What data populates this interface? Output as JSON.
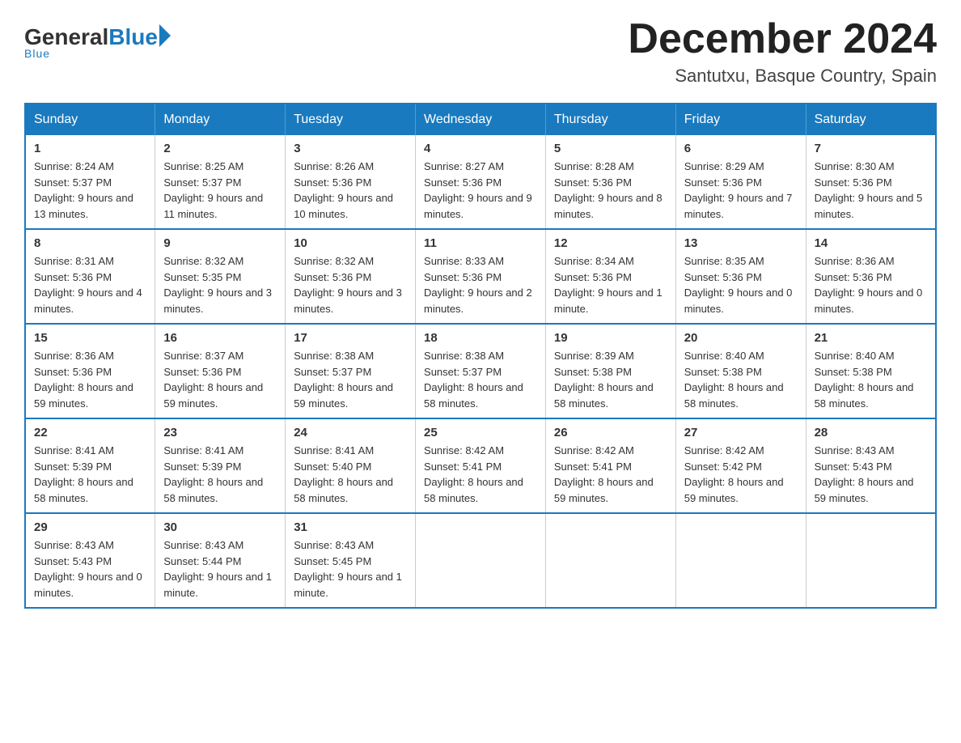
{
  "logo": {
    "general": "General",
    "blue": "Blue",
    "underline": "Blue"
  },
  "title": "December 2024",
  "location": "Santutxu, Basque Country, Spain",
  "days_of_week": [
    "Sunday",
    "Monday",
    "Tuesday",
    "Wednesday",
    "Thursday",
    "Friday",
    "Saturday"
  ],
  "weeks": [
    [
      {
        "day": "1",
        "sunrise": "8:24 AM",
        "sunset": "5:37 PM",
        "daylight": "9 hours and 13 minutes."
      },
      {
        "day": "2",
        "sunrise": "8:25 AM",
        "sunset": "5:37 PM",
        "daylight": "9 hours and 11 minutes."
      },
      {
        "day": "3",
        "sunrise": "8:26 AM",
        "sunset": "5:36 PM",
        "daylight": "9 hours and 10 minutes."
      },
      {
        "day": "4",
        "sunrise": "8:27 AM",
        "sunset": "5:36 PM",
        "daylight": "9 hours and 9 minutes."
      },
      {
        "day": "5",
        "sunrise": "8:28 AM",
        "sunset": "5:36 PM",
        "daylight": "9 hours and 8 minutes."
      },
      {
        "day": "6",
        "sunrise": "8:29 AM",
        "sunset": "5:36 PM",
        "daylight": "9 hours and 7 minutes."
      },
      {
        "day": "7",
        "sunrise": "8:30 AM",
        "sunset": "5:36 PM",
        "daylight": "9 hours and 5 minutes."
      }
    ],
    [
      {
        "day": "8",
        "sunrise": "8:31 AM",
        "sunset": "5:36 PM",
        "daylight": "9 hours and 4 minutes."
      },
      {
        "day": "9",
        "sunrise": "8:32 AM",
        "sunset": "5:35 PM",
        "daylight": "9 hours and 3 minutes."
      },
      {
        "day": "10",
        "sunrise": "8:32 AM",
        "sunset": "5:36 PM",
        "daylight": "9 hours and 3 minutes."
      },
      {
        "day": "11",
        "sunrise": "8:33 AM",
        "sunset": "5:36 PM",
        "daylight": "9 hours and 2 minutes."
      },
      {
        "day": "12",
        "sunrise": "8:34 AM",
        "sunset": "5:36 PM",
        "daylight": "9 hours and 1 minute."
      },
      {
        "day": "13",
        "sunrise": "8:35 AM",
        "sunset": "5:36 PM",
        "daylight": "9 hours and 0 minutes."
      },
      {
        "day": "14",
        "sunrise": "8:36 AM",
        "sunset": "5:36 PM",
        "daylight": "9 hours and 0 minutes."
      }
    ],
    [
      {
        "day": "15",
        "sunrise": "8:36 AM",
        "sunset": "5:36 PM",
        "daylight": "8 hours and 59 minutes."
      },
      {
        "day": "16",
        "sunrise": "8:37 AM",
        "sunset": "5:36 PM",
        "daylight": "8 hours and 59 minutes."
      },
      {
        "day": "17",
        "sunrise": "8:38 AM",
        "sunset": "5:37 PM",
        "daylight": "8 hours and 59 minutes."
      },
      {
        "day": "18",
        "sunrise": "8:38 AM",
        "sunset": "5:37 PM",
        "daylight": "8 hours and 58 minutes."
      },
      {
        "day": "19",
        "sunrise": "8:39 AM",
        "sunset": "5:38 PM",
        "daylight": "8 hours and 58 minutes."
      },
      {
        "day": "20",
        "sunrise": "8:40 AM",
        "sunset": "5:38 PM",
        "daylight": "8 hours and 58 minutes."
      },
      {
        "day": "21",
        "sunrise": "8:40 AM",
        "sunset": "5:38 PM",
        "daylight": "8 hours and 58 minutes."
      }
    ],
    [
      {
        "day": "22",
        "sunrise": "8:41 AM",
        "sunset": "5:39 PM",
        "daylight": "8 hours and 58 minutes."
      },
      {
        "day": "23",
        "sunrise": "8:41 AM",
        "sunset": "5:39 PM",
        "daylight": "8 hours and 58 minutes."
      },
      {
        "day": "24",
        "sunrise": "8:41 AM",
        "sunset": "5:40 PM",
        "daylight": "8 hours and 58 minutes."
      },
      {
        "day": "25",
        "sunrise": "8:42 AM",
        "sunset": "5:41 PM",
        "daylight": "8 hours and 58 minutes."
      },
      {
        "day": "26",
        "sunrise": "8:42 AM",
        "sunset": "5:41 PM",
        "daylight": "8 hours and 59 minutes."
      },
      {
        "day": "27",
        "sunrise": "8:42 AM",
        "sunset": "5:42 PM",
        "daylight": "8 hours and 59 minutes."
      },
      {
        "day": "28",
        "sunrise": "8:43 AM",
        "sunset": "5:43 PM",
        "daylight": "8 hours and 59 minutes."
      }
    ],
    [
      {
        "day": "29",
        "sunrise": "8:43 AM",
        "sunset": "5:43 PM",
        "daylight": "9 hours and 0 minutes."
      },
      {
        "day": "30",
        "sunrise": "8:43 AM",
        "sunset": "5:44 PM",
        "daylight": "9 hours and 1 minute."
      },
      {
        "day": "31",
        "sunrise": "8:43 AM",
        "sunset": "5:45 PM",
        "daylight": "9 hours and 1 minute."
      },
      null,
      null,
      null,
      null
    ]
  ]
}
